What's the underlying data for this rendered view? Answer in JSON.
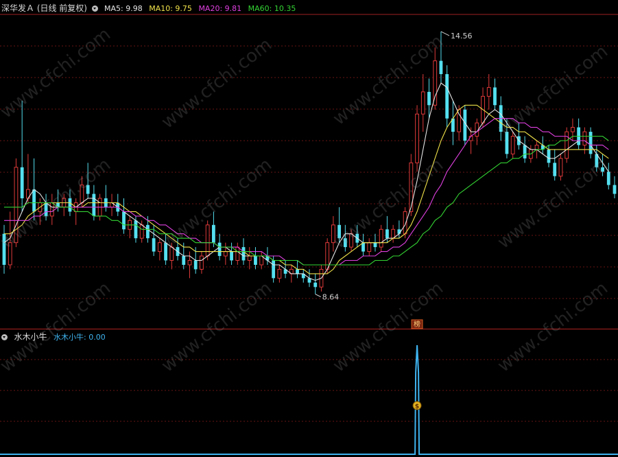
{
  "header": {
    "title": "深华发Ａ (日线 前复权)",
    "ma": [
      {
        "label": "MA5: 9.98",
        "color": "#e6e6e6"
      },
      {
        "label": "MA10: 9.75",
        "color": "#f0e24a"
      },
      {
        "label": "MA20: 9.81",
        "color": "#e040e0"
      },
      {
        "label": "MA60: 10.35",
        "color": "#33d433"
      }
    ]
  },
  "sub": {
    "title": "水木小牛",
    "value_label": "水木小牛: 0.00",
    "value_color": "#3fb4f0"
  },
  "marker_label": "榜",
  "watermark": "www.cfchi.com",
  "chart_data": {
    "type": "candlestick",
    "high_label": "14.56",
    "low_label": "8.64",
    "series": [
      {
        "name": "MA5",
        "color": "#e6e6e6"
      },
      {
        "name": "MA10",
        "color": "#f0e24a"
      },
      {
        "name": "MA20",
        "color": "#e040e0"
      },
      {
        "name": "MA60",
        "color": "#33d433"
      }
    ],
    "up_color": "#e03a3a",
    "down_color": "#54e0f0",
    "candles": [
      [
        10.0,
        10.2,
        9.1,
        9.3
      ],
      [
        9.3,
        10.5,
        9.2,
        9.8
      ],
      [
        9.8,
        11.7,
        9.7,
        11.5
      ],
      [
        11.5,
        13.0,
        10.5,
        10.8
      ],
      [
        10.8,
        11.8,
        10.7,
        11.0
      ],
      [
        11.0,
        11.7,
        10.3,
        10.5
      ],
      [
        10.5,
        10.8,
        10.2,
        10.7
      ],
      [
        10.7,
        10.9,
        10.3,
        10.4
      ],
      [
        10.4,
        10.9,
        10.2,
        10.7
      ],
      [
        10.7,
        11.0,
        10.5,
        10.6
      ],
      [
        10.6,
        10.9,
        10.4,
        10.8
      ],
      [
        10.8,
        11.0,
        10.4,
        10.5
      ],
      [
        10.5,
        10.8,
        10.2,
        10.7
      ],
      [
        10.7,
        11.3,
        10.6,
        11.1
      ],
      [
        11.1,
        11.6,
        10.8,
        10.9
      ],
      [
        10.9,
        11.1,
        10.3,
        10.4
      ],
      [
        10.4,
        10.9,
        10.3,
        10.8
      ],
      [
        10.8,
        11.1,
        10.5,
        10.6
      ],
      [
        10.6,
        10.9,
        10.4,
        10.7
      ],
      [
        10.7,
        10.9,
        10.4,
        10.5
      ],
      [
        10.5,
        10.8,
        10.0,
        10.1
      ],
      [
        10.1,
        10.4,
        9.9,
        10.3
      ],
      [
        10.3,
        10.4,
        9.8,
        9.9
      ],
      [
        9.9,
        10.3,
        9.8,
        10.2
      ],
      [
        10.2,
        10.4,
        9.8,
        9.9
      ],
      [
        9.9,
        10.2,
        9.5,
        9.6
      ],
      [
        9.6,
        9.9,
        9.4,
        9.8
      ],
      [
        9.8,
        10.0,
        9.3,
        9.4
      ],
      [
        9.4,
        9.8,
        9.2,
        9.7
      ],
      [
        9.7,
        9.9,
        9.4,
        9.5
      ],
      [
        9.5,
        9.8,
        9.2,
        9.3
      ],
      [
        9.3,
        9.6,
        9.0,
        9.4
      ],
      [
        9.4,
        9.7,
        9.1,
        9.2
      ],
      [
        9.2,
        9.6,
        9.1,
        9.5
      ],
      [
        9.5,
        10.3,
        9.4,
        10.2
      ],
      [
        10.2,
        10.5,
        9.7,
        9.8
      ],
      [
        9.8,
        10.0,
        9.4,
        9.5
      ],
      [
        9.5,
        9.8,
        9.3,
        9.6
      ],
      [
        9.6,
        9.8,
        9.3,
        9.4
      ],
      [
        9.4,
        9.8,
        9.3,
        9.7
      ],
      [
        9.7,
        9.9,
        9.3,
        9.4
      ],
      [
        9.4,
        9.7,
        9.2,
        9.5
      ],
      [
        9.5,
        9.7,
        9.2,
        9.3
      ],
      [
        9.3,
        9.6,
        9.2,
        9.5
      ],
      [
        9.5,
        9.7,
        9.3,
        9.4
      ],
      [
        9.4,
        9.5,
        8.9,
        9.0
      ],
      [
        9.0,
        9.3,
        8.9,
        9.2
      ],
      [
        9.2,
        9.4,
        9.0,
        9.1
      ],
      [
        9.1,
        9.3,
        8.9,
        9.2
      ],
      [
        9.2,
        9.4,
        9.0,
        9.1
      ],
      [
        9.1,
        9.2,
        8.9,
        9.0
      ],
      [
        9.0,
        9.2,
        8.8,
        8.9
      ],
      [
        8.9,
        9.1,
        8.64,
        8.8
      ],
      [
        8.8,
        9.3,
        8.7,
        9.2
      ],
      [
        9.2,
        9.9,
        9.1,
        9.8
      ],
      [
        9.8,
        10.4,
        9.6,
        10.2
      ],
      [
        10.2,
        10.6,
        9.8,
        9.9
      ],
      [
        9.9,
        10.2,
        9.6,
        9.7
      ],
      [
        9.7,
        10.1,
        9.6,
        10.0
      ],
      [
        10.0,
        10.2,
        9.7,
        9.8
      ],
      [
        9.8,
        10.0,
        9.5,
        9.6
      ],
      [
        9.6,
        9.9,
        9.5,
        9.8
      ],
      [
        9.8,
        10.0,
        9.6,
        9.7
      ],
      [
        9.7,
        10.2,
        9.6,
        10.1
      ],
      [
        10.1,
        10.4,
        9.8,
        9.9
      ],
      [
        9.9,
        10.2,
        9.8,
        10.1
      ],
      [
        10.1,
        10.3,
        9.9,
        10.0
      ],
      [
        10.0,
        10.6,
        9.9,
        10.5
      ],
      [
        10.5,
        11.8,
        10.4,
        11.6
      ],
      [
        11.6,
        12.9,
        11.4,
        12.7
      ],
      [
        12.7,
        13.6,
        12.3,
        13.2
      ],
      [
        13.2,
        13.5,
        12.6,
        12.9
      ],
      [
        12.9,
        14.2,
        12.8,
        13.9
      ],
      [
        13.9,
        14.56,
        13.4,
        13.6
      ],
      [
        13.6,
        13.8,
        12.4,
        12.6
      ],
      [
        12.6,
        13.0,
        12.0,
        12.3
      ],
      [
        12.3,
        12.9,
        12.1,
        12.8
      ],
      [
        12.8,
        12.9,
        12.0,
        12.1
      ],
      [
        12.1,
        12.4,
        11.8,
        12.2
      ],
      [
        12.2,
        12.6,
        12.0,
        12.5
      ],
      [
        12.5,
        13.3,
        12.4,
        13.1
      ],
      [
        13.1,
        13.6,
        12.8,
        13.3
      ],
      [
        13.3,
        13.5,
        12.8,
        12.9
      ],
      [
        12.9,
        13.1,
        12.1,
        12.3
      ],
      [
        12.3,
        12.6,
        11.7,
        11.8
      ],
      [
        11.8,
        12.3,
        11.7,
        12.2
      ],
      [
        12.2,
        12.5,
        11.9,
        12.0
      ],
      [
        12.0,
        12.2,
        11.6,
        11.7
      ],
      [
        11.7,
        12.0,
        11.6,
        11.9
      ],
      [
        11.9,
        12.1,
        11.7,
        12.0
      ],
      [
        12.0,
        12.2,
        11.8,
        11.9
      ],
      [
        11.9,
        12.0,
        11.5,
        11.6
      ],
      [
        11.6,
        11.9,
        11.2,
        11.3
      ],
      [
        11.3,
        11.8,
        11.2,
        11.7
      ],
      [
        11.7,
        12.4,
        11.6,
        12.3
      ],
      [
        12.3,
        12.6,
        12.1,
        12.4
      ],
      [
        12.4,
        12.6,
        11.9,
        12.0
      ],
      [
        12.0,
        12.4,
        11.8,
        12.3
      ],
      [
        12.3,
        12.4,
        11.7,
        11.8
      ],
      [
        11.8,
        12.0,
        11.4,
        11.5
      ],
      [
        11.5,
        11.8,
        11.3,
        11.4
      ],
      [
        11.4,
        11.6,
        11.0,
        11.1
      ],
      [
        11.1,
        11.3,
        10.8,
        10.9
      ]
    ],
    "ma5": [
      9.8,
      9.9,
      10.2,
      10.5,
      10.8,
      11.0,
      10.9,
      10.7,
      10.6,
      10.6,
      10.6,
      10.6,
      10.6,
      10.7,
      10.8,
      10.8,
      10.7,
      10.7,
      10.7,
      10.6,
      10.5,
      10.4,
      10.3,
      10.2,
      10.1,
      10.0,
      9.9,
      9.8,
      9.7,
      9.6,
      9.5,
      9.5,
      9.4,
      9.4,
      9.5,
      9.6,
      9.7,
      9.7,
      9.6,
      9.6,
      9.5,
      9.5,
      9.5,
      9.5,
      9.4,
      9.3,
      9.3,
      9.2,
      9.1,
      9.1,
      9.1,
      9.0,
      8.95,
      9.0,
      9.2,
      9.5,
      9.8,
      10.0,
      10.0,
      9.9,
      9.8,
      9.8,
      9.8,
      9.8,
      9.9,
      9.9,
      10.0,
      10.2,
      10.6,
      11.2,
      11.9,
      12.6,
      13.1,
      13.4,
      13.3,
      13.0,
      12.7,
      12.5,
      12.3,
      12.3,
      12.5,
      12.7,
      12.8,
      12.7,
      12.5,
      12.3,
      12.1,
      12.0,
      11.9,
      11.9,
      11.8,
      11.7,
      11.7,
      11.8,
      11.9,
      12.0,
      12.1,
      12.1,
      12.0,
      11.8,
      11.6,
      11.4
    ],
    "ma10": [
      10.0,
      10.0,
      10.1,
      10.2,
      10.4,
      10.5,
      10.6,
      10.7,
      10.7,
      10.7,
      10.7,
      10.7,
      10.6,
      10.6,
      10.7,
      10.7,
      10.7,
      10.7,
      10.7,
      10.7,
      10.6,
      10.5,
      10.5,
      10.4,
      10.3,
      10.2,
      10.1,
      10.0,
      9.9,
      9.8,
      9.7,
      9.7,
      9.6,
      9.6,
      9.6,
      9.6,
      9.6,
      9.6,
      9.6,
      9.6,
      9.6,
      9.5,
      9.5,
      9.5,
      9.5,
      9.4,
      9.4,
      9.3,
      9.3,
      9.2,
      9.2,
      9.1,
      9.1,
      9.1,
      9.1,
      9.2,
      9.4,
      9.5,
      9.6,
      9.7,
      9.8,
      9.8,
      9.8,
      9.8,
      9.8,
      9.9,
      9.9,
      10.0,
      10.2,
      10.5,
      10.9,
      11.3,
      11.7,
      12.1,
      12.4,
      12.6,
      12.8,
      12.9,
      12.9,
      12.9,
      12.8,
      12.7,
      12.6,
      12.5,
      12.4,
      12.4,
      12.3,
      12.3,
      12.2,
      12.1,
      12.0,
      11.9,
      11.9,
      11.9,
      11.9,
      11.9,
      11.9,
      11.9,
      11.9,
      11.9,
      11.8,
      11.7
    ],
    "ma20": [
      10.3,
      10.3,
      10.3,
      10.3,
      10.3,
      10.4,
      10.4,
      10.5,
      10.5,
      10.6,
      10.6,
      10.6,
      10.6,
      10.6,
      10.6,
      10.6,
      10.6,
      10.6,
      10.6,
      10.6,
      10.5,
      10.5,
      10.4,
      10.4,
      10.3,
      10.3,
      10.2,
      10.2,
      10.1,
      10.0,
      10.0,
      9.9,
      9.9,
      9.8,
      9.8,
      9.8,
      9.7,
      9.7,
      9.7,
      9.7,
      9.6,
      9.6,
      9.6,
      9.6,
      9.5,
      9.5,
      9.5,
      9.4,
      9.4,
      9.4,
      9.3,
      9.3,
      9.3,
      9.3,
      9.3,
      9.3,
      9.3,
      9.4,
      9.4,
      9.4,
      9.5,
      9.5,
      9.5,
      9.6,
      9.6,
      9.7,
      9.7,
      9.8,
      10.0,
      10.2,
      10.4,
      10.6,
      10.9,
      11.1,
      11.4,
      11.6,
      11.8,
      12.0,
      12.2,
      12.3,
      12.4,
      12.5,
      12.6,
      12.6,
      12.6,
      12.6,
      12.5,
      12.5,
      12.4,
      12.4,
      12.3,
      12.3,
      12.2,
      12.2,
      12.2,
      12.1,
      12.1,
      12.1,
      12.0,
      12.0,
      12.0,
      11.9
    ],
    "ma60": [
      10.6,
      10.6,
      10.6,
      10.6,
      10.7,
      10.7,
      10.7,
      10.7,
      10.7,
      10.6,
      10.6,
      10.6,
      10.5,
      10.5,
      10.5,
      10.4,
      10.4,
      10.4,
      10.3,
      10.3,
      10.2,
      10.2,
      10.2,
      10.1,
      10.1,
      10.1,
      10.0,
      10.0,
      10.0,
      9.9,
      9.9,
      9.9,
      9.8,
      9.8,
      9.8,
      9.8,
      9.7,
      9.7,
      9.7,
      9.6,
      9.6,
      9.6,
      9.5,
      9.5,
      9.5,
      9.4,
      9.4,
      9.4,
      9.4,
      9.4,
      9.3,
      9.3,
      9.3,
      9.3,
      9.3,
      9.3,
      9.3,
      9.3,
      9.3,
      9.3,
      9.3,
      9.3,
      9.4,
      9.4,
      9.4,
      9.5,
      9.5,
      9.6,
      9.7,
      9.8,
      10.0,
      10.1,
      10.3,
      10.4,
      10.6,
      10.7,
      10.9,
      11.0,
      11.1,
      11.2,
      11.3,
      11.4,
      11.5,
      11.6,
      11.6,
      11.7,
      11.7,
      11.8,
      11.8,
      11.9,
      11.9,
      12.0,
      12.0,
      12.1,
      12.1,
      12.2,
      12.2,
      12.2,
      12.2,
      12.2,
      12.2,
      12.1
    ],
    "indicator": {
      "name": "水木小牛",
      "spike_index": 69,
      "spike_value": 1.0,
      "current": 0.0
    }
  }
}
